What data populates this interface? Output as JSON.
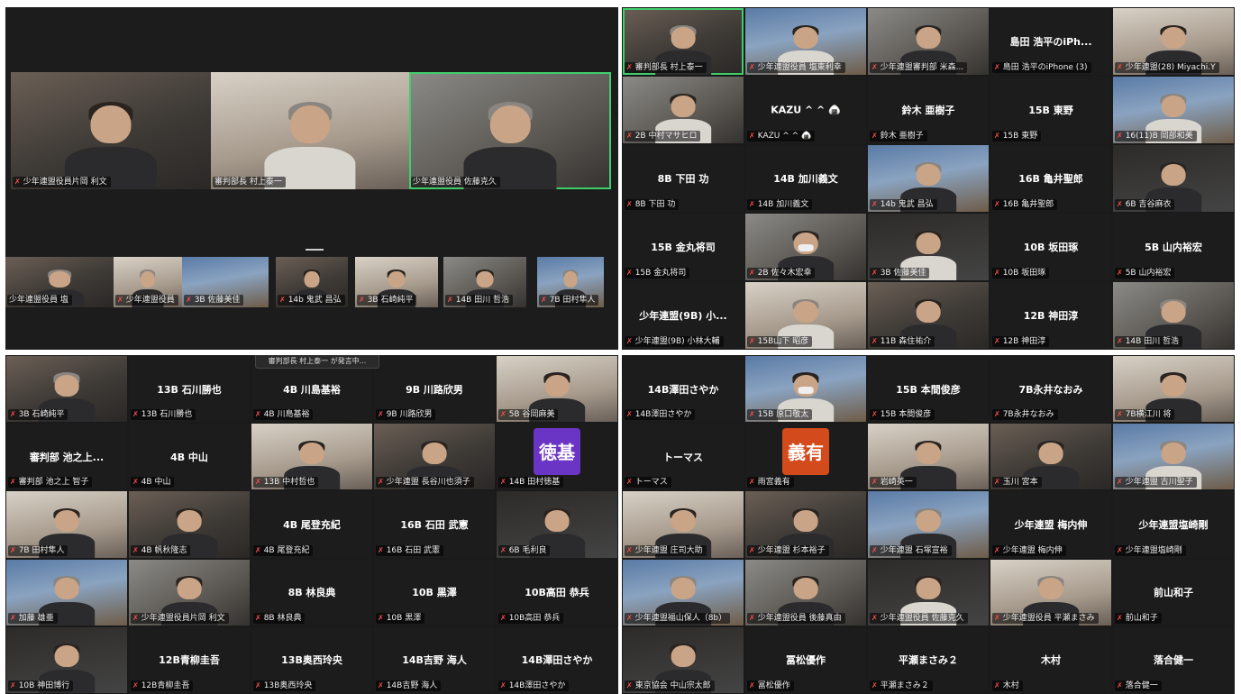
{
  "ui": {
    "mic_icon": "mic-muted-icon"
  },
  "q1": {
    "speakers": [
      {
        "label": "少年連盟役員片岡 利文"
      },
      {
        "label": "審判部長 村上泰一"
      },
      {
        "label": "少年連盟役員 佐藤克久"
      }
    ],
    "strip": [
      {
        "label": "少年連盟役員 塩"
      },
      {
        "label": "少年連盟役員"
      },
      {
        "label": "3B 佐藤美佳"
      },
      {
        "label": "14b 鬼武 昌弘"
      },
      {
        "label": "3B 石崎純平"
      },
      {
        "label": "14B 田川 哲浩"
      },
      {
        "label": "7B 田村隼人"
      }
    ]
  },
  "q2": {
    "tiles": [
      {
        "name": "",
        "label": "審判部長 村上泰一"
      },
      {
        "name": "",
        "label": "少年連盟役員 塩東利幸"
      },
      {
        "name": "",
        "label": "少年連盟審判部 米森..."
      },
      {
        "name": "島田 浩平のiPh...",
        "label": "島田 浩平のiPhone (3)"
      },
      {
        "name": "",
        "label": "少年連盟(28) Miyachi.Y"
      },
      {
        "name": "",
        "label": "2B 中村マサヒロ"
      },
      {
        "name": "KAZU ^ ^ 🍙",
        "label": "KAZU ^ ^ 🍙"
      },
      {
        "name": "鈴木 亜樹子",
        "label": "鈴木 亜樹子"
      },
      {
        "name": "15B 東野",
        "label": "15B 東野"
      },
      {
        "name": "",
        "label": "16(11)B 岡部和美"
      },
      {
        "name": "8B 下田 功",
        "label": "8B 下田 功"
      },
      {
        "name": "14B 加川義文",
        "label": "14B 加川義文"
      },
      {
        "name": "",
        "label": "14b 鬼武 昌弘"
      },
      {
        "name": "16B 亀井聖郎",
        "label": "16B 亀井聖郎"
      },
      {
        "name": "",
        "label": "6B 吉谷麻衣"
      },
      {
        "name": "15B 金丸将司",
        "label": "15B 金丸将司"
      },
      {
        "name": "",
        "label": "2B 佐々木宏幸"
      },
      {
        "name": "",
        "label": "3B 佐藤美佳"
      },
      {
        "name": "10B 坂田琢",
        "label": "10B 坂田琢"
      },
      {
        "name": "5B 山内裕宏",
        "label": "5B 山内裕宏"
      },
      {
        "name": "少年連盟(9B) 小...",
        "label": "少年連盟(9B) 小林大輔"
      },
      {
        "name": "",
        "label": "15B山下 昭彦"
      },
      {
        "name": "",
        "label": "11B 森住祐介"
      },
      {
        "name": "12B 神田淳",
        "label": "12B 神田淳"
      },
      {
        "name": "",
        "label": "14B 田川 哲浩"
      }
    ]
  },
  "q3": {
    "toast": "審判部長 村上泰一 が発言中...",
    "tiles": [
      {
        "name": "",
        "label": "3B 石崎純平"
      },
      {
        "name": "13B 石川勝也",
        "label": "13B 石川勝也"
      },
      {
        "name": "4B 川島基裕",
        "label": "4B 川島基裕"
      },
      {
        "name": "9B 川路欣男",
        "label": "9B 川路欣男"
      },
      {
        "name": "",
        "label": "5B 谷岡麻美"
      },
      {
        "name": "審判部 池之上...",
        "label": "審判部 池之上 智子"
      },
      {
        "name": "4B 中山",
        "label": "4B 中山"
      },
      {
        "name": "",
        "label": "13B 中村哲也"
      },
      {
        "name": "",
        "label": "少年連盟 長谷川也須子"
      },
      {
        "name": "徳基",
        "label": "14B 田村徳基"
      },
      {
        "name": "",
        "label": "7B 田村隼人"
      },
      {
        "name": "",
        "label": "4B 帆秋隆志"
      },
      {
        "name": "4B 尾登充紀",
        "label": "4B 尾登充紀"
      },
      {
        "name": "16B 石田 武憲",
        "label": "16B 石田 武憲"
      },
      {
        "name": "",
        "label": "6B 毛利良"
      },
      {
        "name": "",
        "label": "加藤 雄亜"
      },
      {
        "name": "",
        "label": "少年連盟役員片岡 利文"
      },
      {
        "name": "8B 林良典",
        "label": "8B 林良典"
      },
      {
        "name": "10B 黒澤",
        "label": "10B 黒澤"
      },
      {
        "name": "10B高田 恭兵",
        "label": "10B高田 恭兵"
      },
      {
        "name": "",
        "label": "10B 神田博行"
      },
      {
        "name": "12B青柳圭吾",
        "label": "12B青柳圭吾"
      },
      {
        "name": "13B奥西玲央",
        "label": "13B奥西玲央"
      },
      {
        "name": "14B吉野 海人",
        "label": "14B吉野 海人"
      },
      {
        "name": "14B澤田さやか",
        "label": "14B澤田さやか"
      }
    ]
  },
  "q4": {
    "tiles": [
      {
        "name": "14B澤田さやか",
        "label": "14B澤田さやか"
      },
      {
        "name": "",
        "label": "15B 原口敬太"
      },
      {
        "name": "15B 本間俊彦",
        "label": "15B 本間俊彦"
      },
      {
        "name": "7B永井なおみ",
        "label": "7B永井なおみ"
      },
      {
        "name": "",
        "label": "7B横江川 将"
      },
      {
        "name": "トーマス",
        "label": "トーマス"
      },
      {
        "name": "義有",
        "label": "雨宮義有"
      },
      {
        "name": "",
        "label": "岩崎英一"
      },
      {
        "name": "",
        "label": "玉川 宮本"
      },
      {
        "name": "",
        "label": "少年連盟 古川聖子"
      },
      {
        "name": "",
        "label": "少年連盟 庄司大助"
      },
      {
        "name": "",
        "label": "少年連盟 杉本裕子"
      },
      {
        "name": "",
        "label": "少年連盟 石塚宣裕"
      },
      {
        "name": "少年連盟 梅内伸",
        "label": "少年連盟 梅内伸"
      },
      {
        "name": "少年連盟塩崎剛",
        "label": "少年連盟塩崎剛"
      },
      {
        "name": "",
        "label": "少年連盟福山保人（8b）"
      },
      {
        "name": "",
        "label": "少年連盟役員 後藤真由"
      },
      {
        "name": "",
        "label": "少年連盟役員 佐藤克久"
      },
      {
        "name": "",
        "label": "少年連盟役員 平瀬まさみ"
      },
      {
        "name": "前山和子",
        "label": "前山和子"
      },
      {
        "name": "",
        "label": "東京協会 中山宗太郎"
      },
      {
        "name": "冨松優作",
        "label": "冨松優作"
      },
      {
        "name": "平瀬まさみ２",
        "label": "平瀬まさみ２"
      },
      {
        "name": "木村",
        "label": "木村"
      },
      {
        "name": "落合健一",
        "label": "落合健一"
      }
    ]
  }
}
